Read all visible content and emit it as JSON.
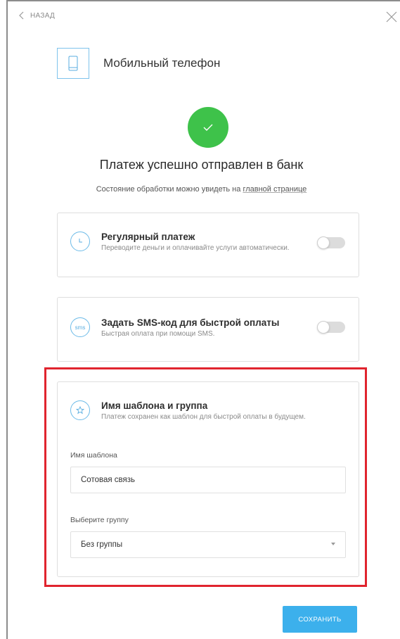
{
  "nav": {
    "back_label": "НАЗАД"
  },
  "header": {
    "title": "Мобильный телефон"
  },
  "result": {
    "title": "Платеж успешно отправлен в банк",
    "subtitle_prefix": "Состояние обработки можно увидеть на ",
    "subtitle_link": "главной странице"
  },
  "options": {
    "regular": {
      "title": "Регулярный платеж",
      "description": "Переводите деньги и оплачивайте услуги автоматически.",
      "enabled": false
    },
    "sms": {
      "icon_text": "sms",
      "title": "Задать SMS-код для быстрой оплаты",
      "description": "Быстрая оплата при помощи SMS.",
      "enabled": false
    }
  },
  "template": {
    "title": "Имя шаблона и группа",
    "description": "Платеж сохранен как шаблон для быстрой оплаты в будущем.",
    "name_label": "Имя шаблона",
    "name_value": "Сотовая связь",
    "group_label": "Выберите группу",
    "group_value": "Без группы"
  },
  "actions": {
    "save_label": "СОХРАНИТЬ"
  },
  "colors": {
    "accent": "#3cb0ec",
    "success": "#3ec24a",
    "highlight": "#e0242e",
    "icon_outline": "#6dbbe8"
  },
  "icons": {
    "back": "chevron-left-icon",
    "close": "close-icon",
    "phone": "phone-icon",
    "success": "check-icon",
    "regular": "clock-icon",
    "sms": "sms-icon",
    "template": "star-icon"
  }
}
